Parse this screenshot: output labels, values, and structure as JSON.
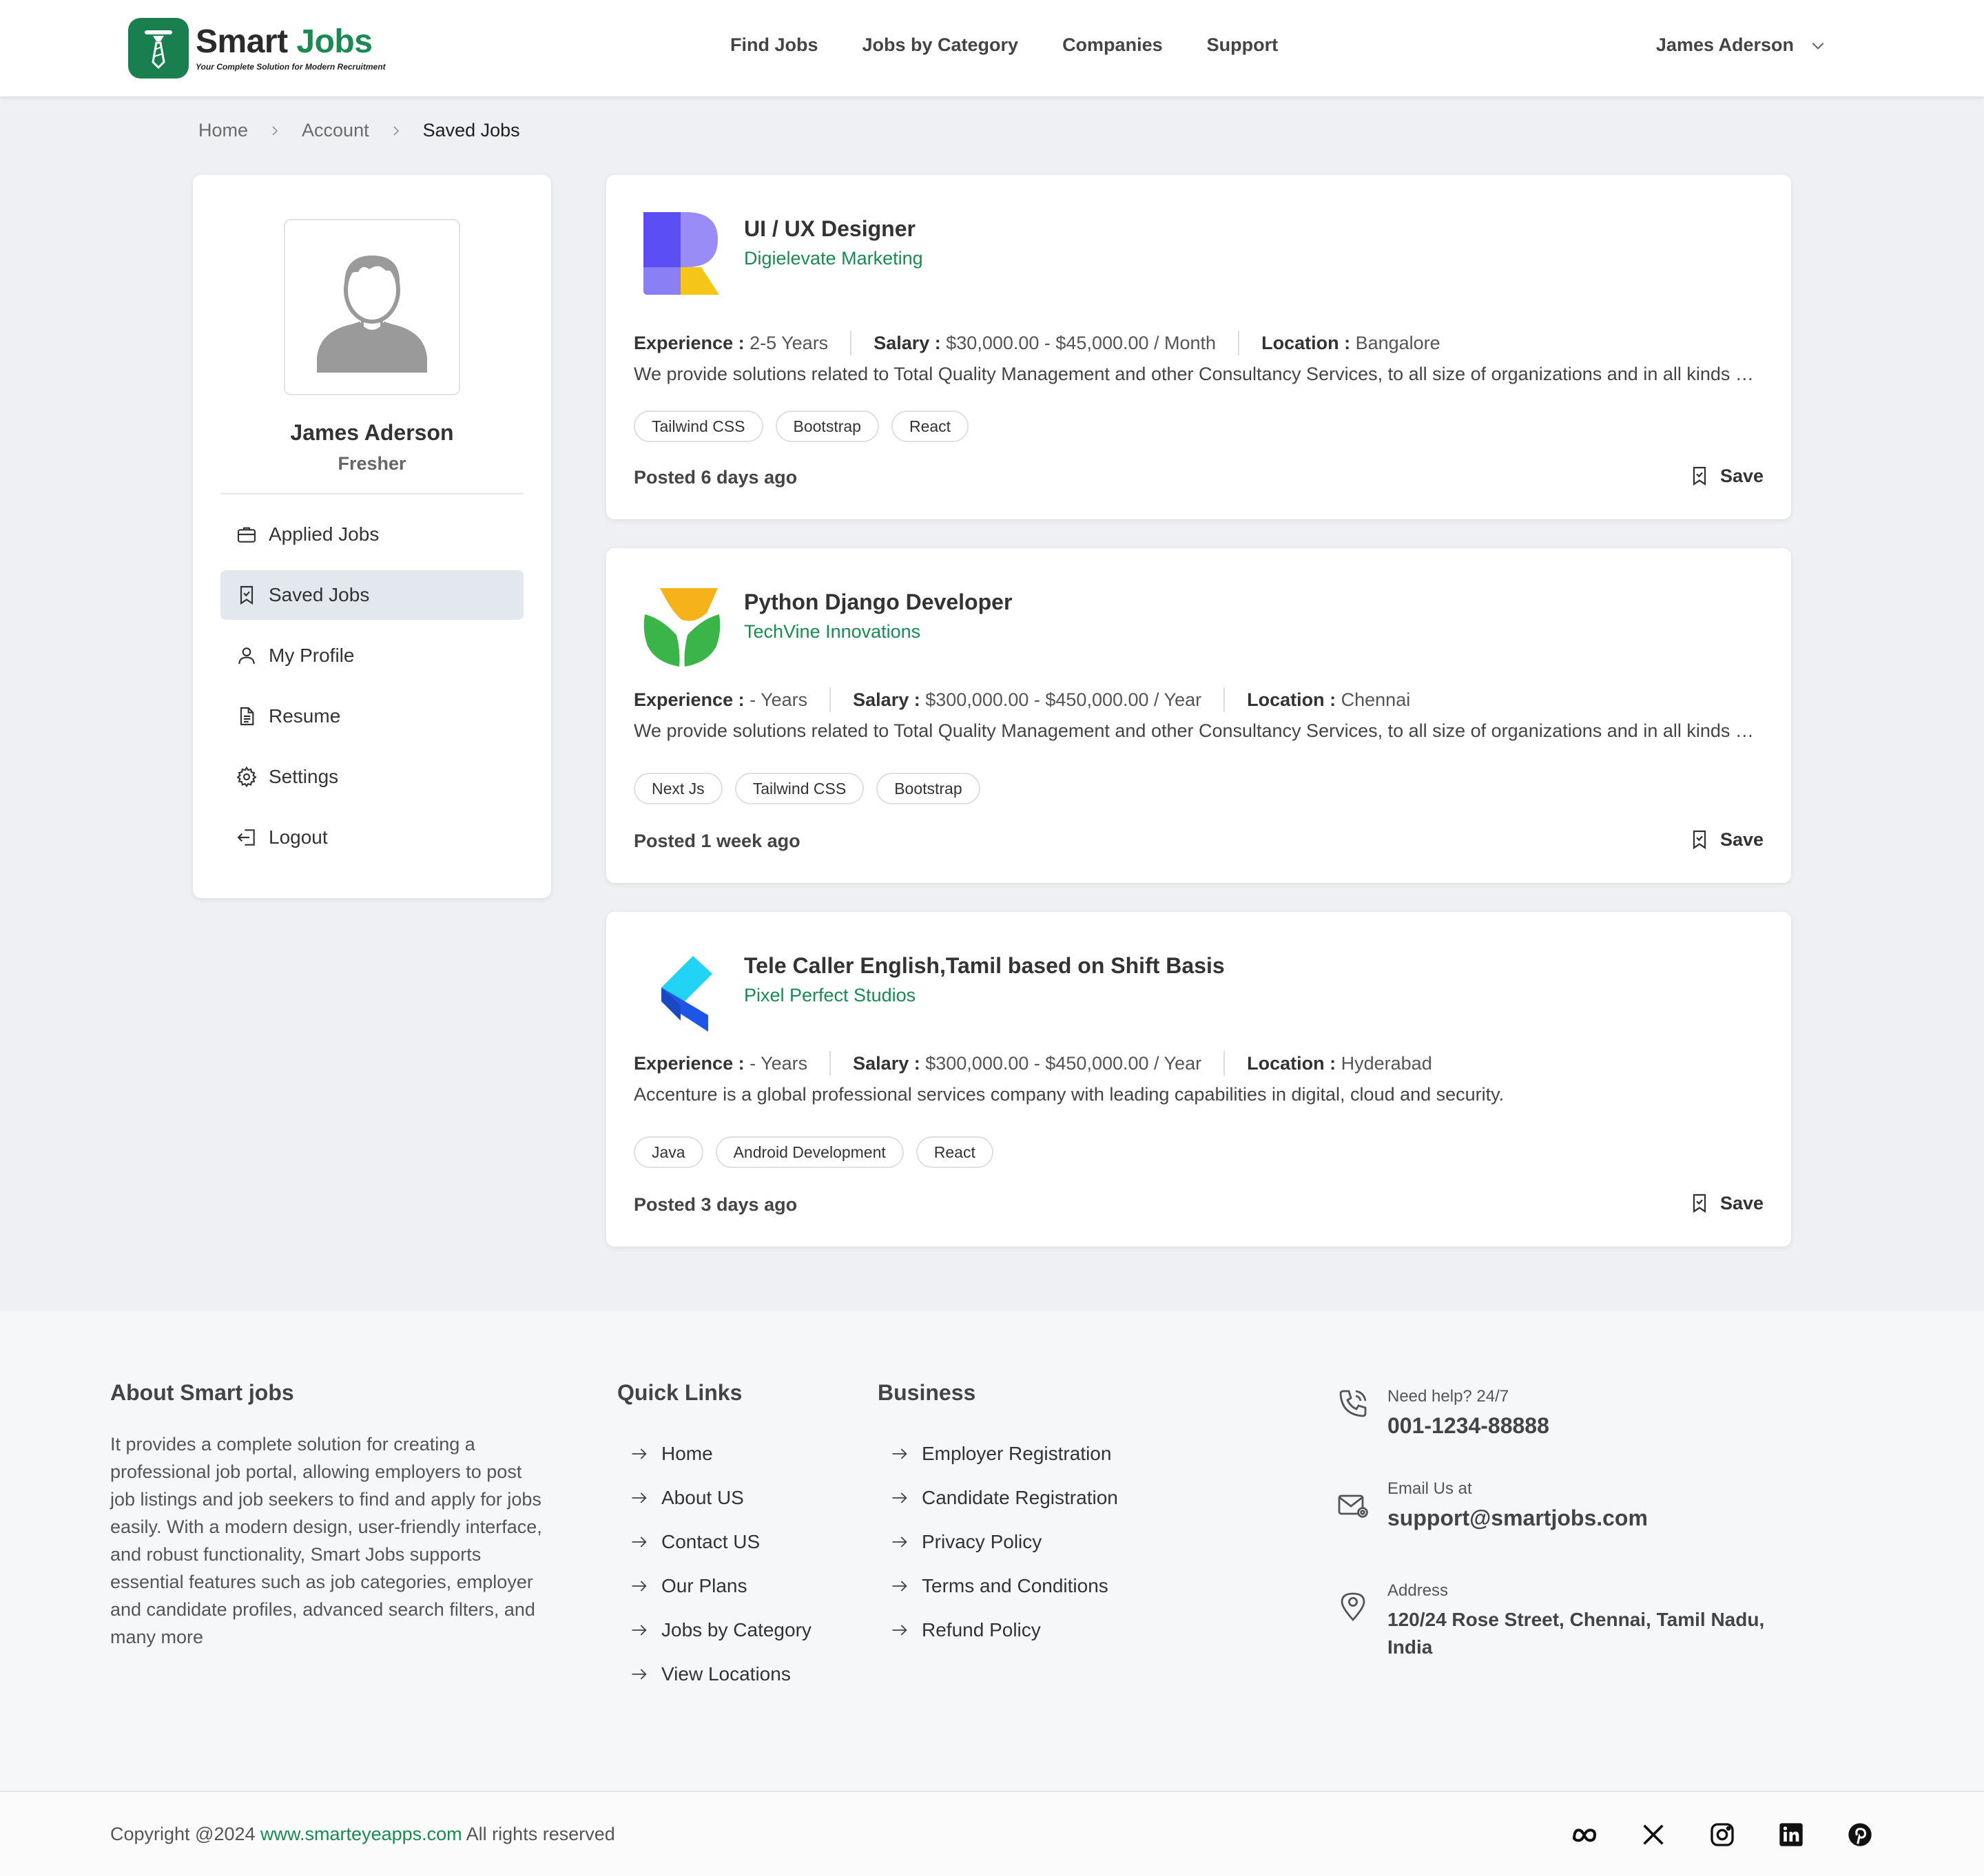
{
  "brand": {
    "name_part1": "Smart",
    "name_part2": "Jobs",
    "tagline": "Your Complete Solution for Modern Recruitment",
    "color_primary": "#1a7f4e",
    "color_accent": "#1a8a52"
  },
  "nav": {
    "items": [
      "Find Jobs",
      "Jobs by Category",
      "Companies",
      "Support"
    ],
    "user_name": "James Aderson"
  },
  "breadcrumb": [
    "Home",
    "Account",
    "Saved Jobs"
  ],
  "sidebar": {
    "name": "James Aderson",
    "role": "Fresher",
    "menu": [
      {
        "label": "Applied Jobs",
        "icon": "briefcase-icon"
      },
      {
        "label": "Saved Jobs",
        "icon": "bookmark-check-icon",
        "active": true
      },
      {
        "label": "My Profile",
        "icon": "user-icon"
      },
      {
        "label": "Resume",
        "icon": "document-icon"
      },
      {
        "label": "Settings",
        "icon": "gear-icon"
      },
      {
        "label": "Logout",
        "icon": "logout-icon"
      }
    ]
  },
  "labels": {
    "experience": "Experience :",
    "salary": "Salary :",
    "location": "Location :",
    "save": "Save"
  },
  "jobs": [
    {
      "title": "UI / UX Designer",
      "company": "Digielevate Marketing",
      "experience": "2-5 Years",
      "salary": "$30,000.00 - $45,000.00 / Month",
      "location": "Bangalore",
      "description": "We provide solutions related to Total Quality Management and other Consultancy Services, to all size of organizations and in all kinds of sectors.",
      "tags": [
        "Tailwind CSS",
        "Bootstrap",
        "React"
      ],
      "posted": "Posted 6 days ago",
      "logo": "r-logo-icon"
    },
    {
      "title": "Python Django Developer",
      "company": "TechVine Innovations",
      "experience": "- Years",
      "salary": "$300,000.00 - $450,000.00 / Year",
      "location": "Chennai",
      "description": "We provide solutions related to Total Quality Management and other Consultancy Services, to all size of organizations and in all kinds of sectors.",
      "tags": [
        "Next Js",
        "Tailwind CSS",
        "Bootstrap"
      ],
      "posted": "Posted 1 week ago",
      "logo": "leaf-logo-icon"
    },
    {
      "title": "Tele Caller English,Tamil based on Shift Basis",
      "company": "Pixel Perfect Studios",
      "experience": "- Years",
      "salary": "$300,000.00 - $450,000.00 / Year",
      "location": "Hyderabad",
      "description": "Accenture is a global professional services company with leading capabilities in digital, cloud and security.",
      "tags": [
        "Java",
        "Android Development",
        "React"
      ],
      "posted": "Posted 3 days ago",
      "logo": "k-logo-icon"
    }
  ],
  "footer": {
    "about_heading": "About Smart jobs",
    "about_text": "It provides a complete solution for creating a professional job portal, allowing employers to post job listings and job seekers to find and apply for jobs easily. With a modern design, user-friendly interface, and robust functionality, Smart Jobs supports essential features such as job categories, employer and candidate profiles, advanced search filters, and many more",
    "quick_links_heading": "Quick Links",
    "quick_links": [
      "Home",
      "About US",
      "Contact US",
      "Our Plans",
      "Jobs by Category",
      "View Locations"
    ],
    "business_heading": "Business",
    "business_links": [
      "Employer Registration",
      "Candidate Registration",
      "Privacy Policy",
      "Terms and Conditions",
      "Refund Policy"
    ],
    "contact": {
      "help_label": "Need help? 24/7",
      "phone": "001-1234-88888",
      "email_label": "Email Us at",
      "email": "support@smartjobs.com",
      "address_label": "Address",
      "address": "120/24 Rose Street, Chennai, Tamil Nadu, India"
    },
    "copyright_prefix": "Copyright @2024",
    "copyright_site": "www.smarteyeapps.com",
    "copyright_suffix": "All rights reserved",
    "socials": [
      "meta-icon",
      "x-icon",
      "instagram-icon",
      "linkedin-icon",
      "pinterest-icon"
    ]
  }
}
